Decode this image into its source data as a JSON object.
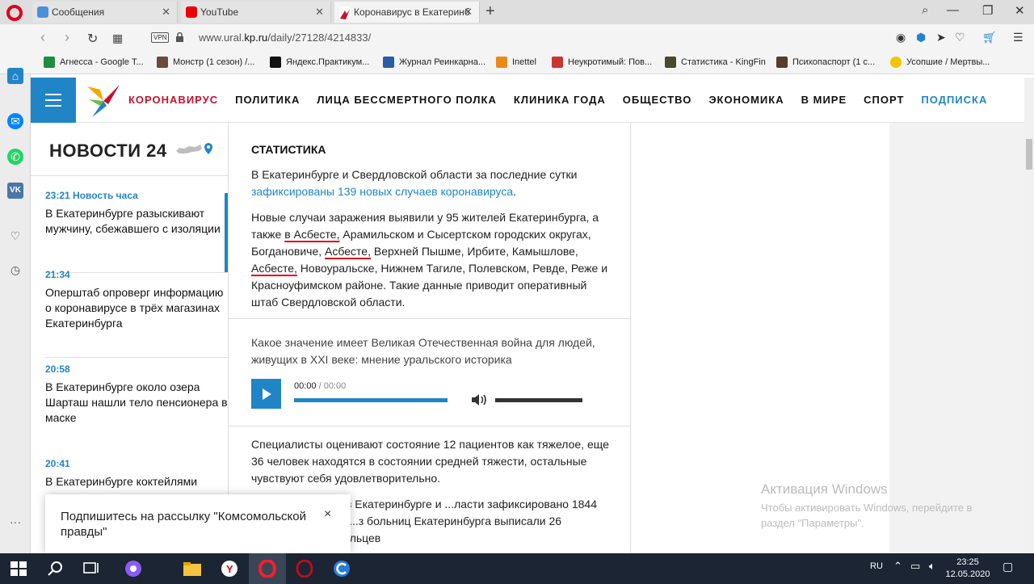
{
  "browser": {
    "tabs": [
      {
        "title": "Сообщения",
        "active": false
      },
      {
        "title": "YouTube",
        "active": false
      },
      {
        "title": "Коронавирус в Екатеринб",
        "active": true
      }
    ],
    "url_prefix": "www.ural.",
    "url_domain": "kp.ru",
    "url_path": "/daily/27128/4214833/",
    "vpn_label": "VPN",
    "bookmarks": [
      "Агнесса - Google Т...",
      "Монстр (1 сезон) /...",
      "Яндекс.Практикум...",
      "Журнал Реинкарна...",
      "Inettel",
      "Неукротимый: Пов...",
      "Статистика - KingFin",
      "Психопаспорт (1 с...",
      "Усопшие / Мертвы..."
    ]
  },
  "site": {
    "nav": [
      "КОРОНАВИРУС",
      "ПОЛИТИКА",
      "ЛИЦА БЕССМЕРТНОГО ПОЛКА",
      "КЛИНИКА ГОДА",
      "ОБЩЕСТВО",
      "ЭКОНОМИКА",
      "В МИРЕ",
      "СПОРТ",
      "ПОДПИСКА"
    ]
  },
  "news": {
    "title": "НОВОСТИ 24",
    "items": [
      {
        "time": "23:21 Новость часа",
        "text": "В Екатеринбурге разыскивают мужчину, сбежавшего с изоляции"
      },
      {
        "time": "21:34",
        "text": "Оперштаб опроверг информацию о коронавирусе в трёх магазинах Екатеринбурга"
      },
      {
        "time": "20:58",
        "text": "В Екатеринбурге около озера Шарташ нашли тело пенсионера в маске"
      },
      {
        "time": "20:41",
        "text": "В Екатеринбурге коктейлями"
      }
    ]
  },
  "article": {
    "heading": "СТАТИСТИКА",
    "p1_text": "В Екатеринбурге и Свердловской области за последние сутки ",
    "p1_link": "зафиксированы 139 новых случаев коронавируса",
    "p1_end": ".",
    "p2_a": "Новые случаи заражения выявили у 95 жителей Екатеринбурга, а также ",
    "p2_u1": "в Асбесте,",
    "p2_b": " Арамильском и Сысертском городских округах, Богдановиче, ",
    "p2_u2": "Асбесте,",
    "p2_c": " Верхней Пышме, Ирбите, Камышлове, ",
    "p2_u3": "Асбесте,",
    "p2_d": " Новоуральске, Нижнем Тагиле, Полевском, Ревде, Реже и Красноуфимском районе. Такие данные приводит оперативный штаб Свердловской области.",
    "audio_title": "Какое значение имеет Великая Отечественная война для людей, живущих в XXI веке: мнение уральского историка",
    "audio_time_current": "00:00",
    "audio_time_sep": " / ",
    "audio_time_total": "00:00",
    "p3": "Специалисты оценивают состояние 12 пациентов как тяжелое, еще 36 человек находятся в состоянии средней тяжести, остальные чувствуют себя удовлетворительно.",
    "p4": "...и коронавируса в Екатеринбурге и ...ласти зафиксировано 1844 случая COVID-19. ...з больниц Екатеринбурга выписали 26 ...болезнь, 250 уральцев"
  },
  "popup": {
    "text": "Подпишитесь на рассылку \"Комсомольской правды\"",
    "close": "×"
  },
  "watermark": {
    "title": "Активация Windows",
    "sub": "Чтобы активировать Windows, перейдите в раздел \"Параметры\"."
  },
  "taskbar": {
    "lang": "RU",
    "time": "23:25",
    "date": "12.05.2020"
  },
  "colors": {
    "accent_blue": "#1f85c7",
    "brand_red": "#c8102e",
    "taskbar": "#1b2533"
  }
}
